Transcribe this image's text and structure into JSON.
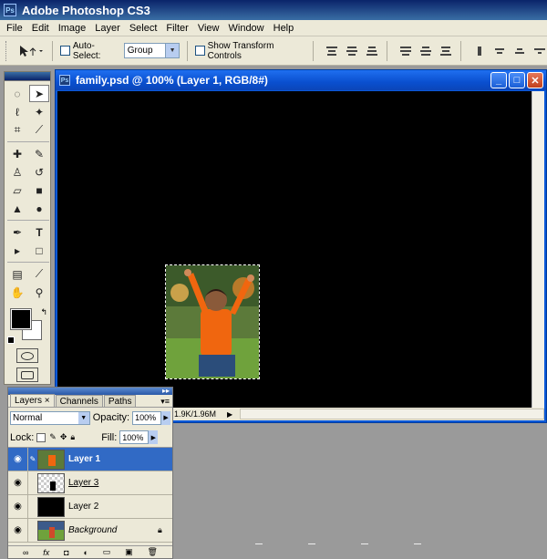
{
  "app": {
    "title": "Adobe Photoshop CS3",
    "logo": "Ps"
  },
  "menu": [
    "File",
    "Edit",
    "Image",
    "Layer",
    "Select",
    "Filter",
    "View",
    "Window",
    "Help"
  ],
  "options": {
    "auto_select_label": "Auto-Select:",
    "auto_select_value": "Group",
    "show_transform_label": "Show Transform Controls"
  },
  "document": {
    "title": "family.psd @ 100% (Layer 1, RGB/8#)",
    "status": "1.9K/1.96M",
    "canvas_color": "#000000"
  },
  "layers_panel": {
    "tabs": [
      "Layers",
      "Channels",
      "Paths"
    ],
    "tab_close": "×",
    "blend_mode": "Normal",
    "opacity_label": "Opacity:",
    "opacity_value": "100%",
    "lock_label": "Lock:",
    "fill_label": "Fill:",
    "fill_value": "100%",
    "layers": [
      {
        "name": "Layer 1",
        "selected": true,
        "thumb": "photo"
      },
      {
        "name": "Layer 3",
        "selected": false,
        "thumb": "checker"
      },
      {
        "name": "Layer 2",
        "selected": false,
        "thumb": "black"
      },
      {
        "name": "Background",
        "selected": false,
        "thumb": "photo",
        "locked": true
      }
    ]
  },
  "colors": {
    "titlebar": "#0a246a",
    "doc_titlebar": "#0a58d8",
    "selected_layer": "#316ac5",
    "foreground": "#000000",
    "background": "#ffffff"
  }
}
